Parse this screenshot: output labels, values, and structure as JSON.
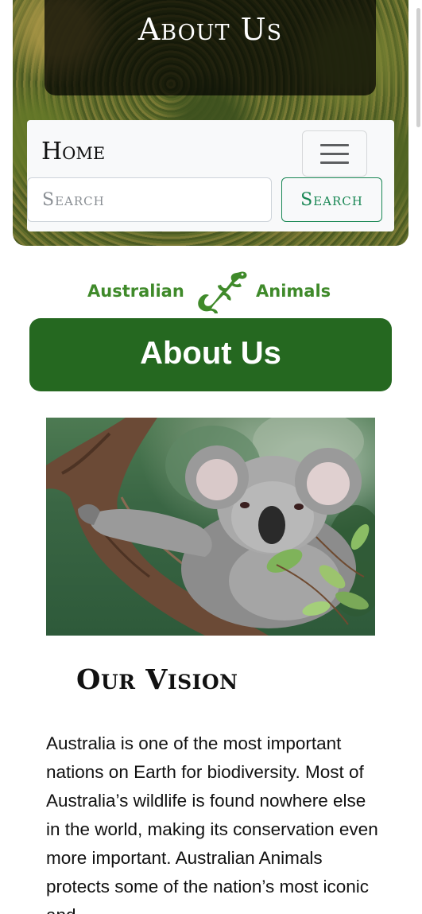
{
  "hero": {
    "title": "About Us"
  },
  "navbar": {
    "home_label": "Home",
    "search_placeholder": "Search",
    "search_button_label": "Search"
  },
  "logo": {
    "word_left": "Australian",
    "word_right": "Animals",
    "color": "#3f8a2a",
    "icon": "lizard-icon"
  },
  "banner": {
    "title": "About Us",
    "color": "#256820"
  },
  "photo": {
    "subject": "koala-photo"
  },
  "vision": {
    "heading": "Our Vision",
    "text": "Australia is one of the most important nations on Earth for biodiversity. Most of Australia’s wildlife is found nowhere else in the world, making its conservation even more important. Australian Animals protects some of the nation’s most iconic and"
  },
  "colors": {
    "accent": "#198754",
    "navbar_bg": "#f8f9fa"
  }
}
